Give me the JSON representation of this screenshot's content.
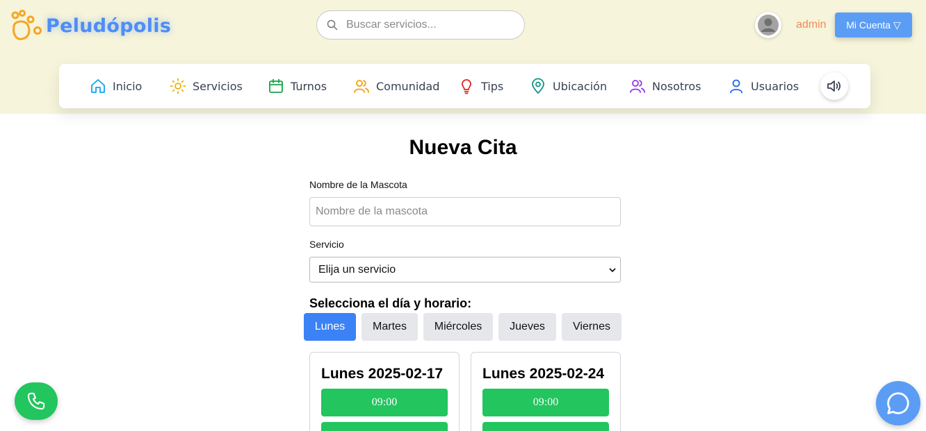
{
  "header": {
    "logo_text": "Peludópolis",
    "logo_icon": "paw-icon",
    "search_placeholder": "Buscar servicios...",
    "username": "admin",
    "account_button": "Mi Cuenta ▽"
  },
  "nav": {
    "items": [
      {
        "label": "Inicio",
        "icon": "home-icon",
        "color": "#0ea5e9"
      },
      {
        "label": "Servicios",
        "icon": "sun-icon",
        "color": "#eab308"
      },
      {
        "label": "Turnos",
        "icon": "calendar-icon",
        "color": "#16a34a"
      },
      {
        "label": "Comunidad",
        "icon": "users-icon",
        "color": "#f59e0b"
      },
      {
        "label": "Tips",
        "icon": "lightbulb-icon",
        "color": "#dc2626"
      },
      {
        "label": "Ubicación",
        "icon": "map-pin-icon",
        "color": "#0d9488"
      },
      {
        "label": "Nosotros",
        "icon": "team-icon",
        "color": "#9333ea"
      },
      {
        "label": "Usuarios",
        "icon": "user-icon",
        "color": "#2563eb"
      }
    ],
    "speaker_icon": "speaker-icon"
  },
  "form": {
    "title": "Nueva Cita",
    "pet_label": "Nombre de la Mascota",
    "pet_placeholder": "Nombre de la mascota",
    "service_label": "Servicio",
    "service_selected": "Elija un servicio",
    "schedule_title": "Selecciona el día y horario:",
    "days": [
      "Lunes",
      "Martes",
      "Miércoles",
      "Jueves",
      "Viernes"
    ],
    "active_day": "Lunes",
    "cards": [
      {
        "title": "Lunes 2025-02-17",
        "slots": [
          "09:00",
          ""
        ]
      },
      {
        "title": "Lunes 2025-02-24",
        "slots": [
          "09:00",
          ""
        ]
      }
    ]
  },
  "fabs": {
    "phone_icon": "phone-icon",
    "chat_icon": "chat-icon"
  },
  "colors": {
    "header_bg": "#f6f4da",
    "brand_blue": "#4e8df5",
    "accent_orange": "#f28a5b",
    "active_day": "#3b82f6",
    "slot_green": "#22c55e"
  }
}
